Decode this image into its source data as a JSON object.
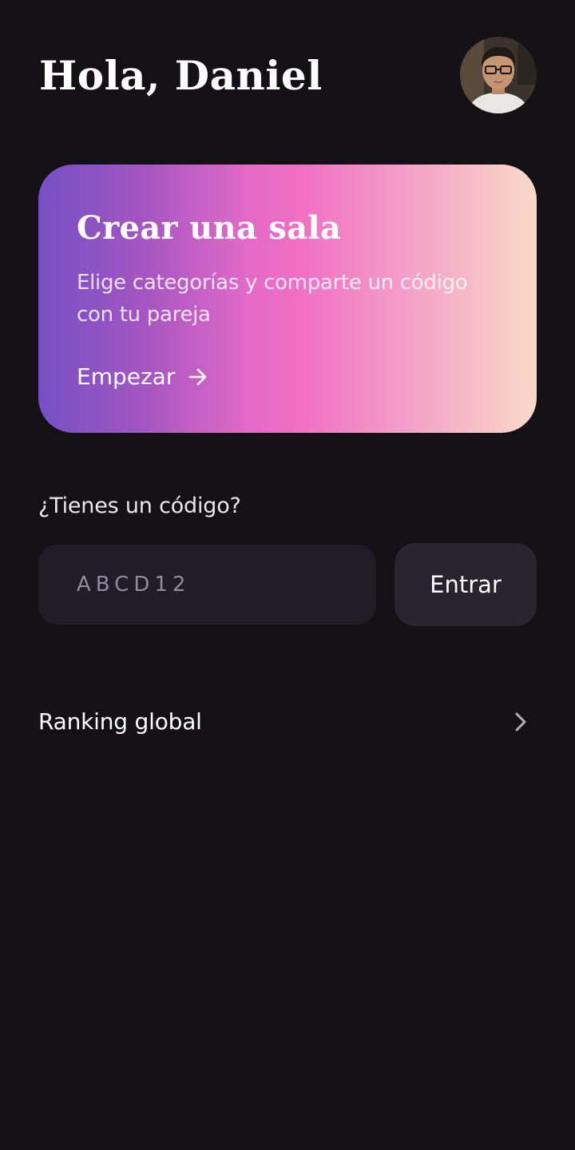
{
  "header": {
    "greeting": "Hola, Daniel",
    "avatar_icon": "user-photo-avatar"
  },
  "create_room": {
    "title": "Crear una sala",
    "description": "Elige categorías y comparte un código con tu pareja",
    "cta_label": "Empezar",
    "cta_icon": "arrow-right-icon",
    "gradient_colors": [
      "#7450c4",
      "#e36ac8",
      "#f16fc4",
      "#fbdac9"
    ]
  },
  "join": {
    "label": "¿Tienes un código?",
    "placeholder": "ABCD12",
    "value": "",
    "button_label": "Entrar"
  },
  "ranking": {
    "label": "Ranking global",
    "icon": "chevron-right-icon"
  },
  "colors": {
    "background": "#131116",
    "input_bg": "#1f1c26",
    "button_bg": "#27232f"
  }
}
